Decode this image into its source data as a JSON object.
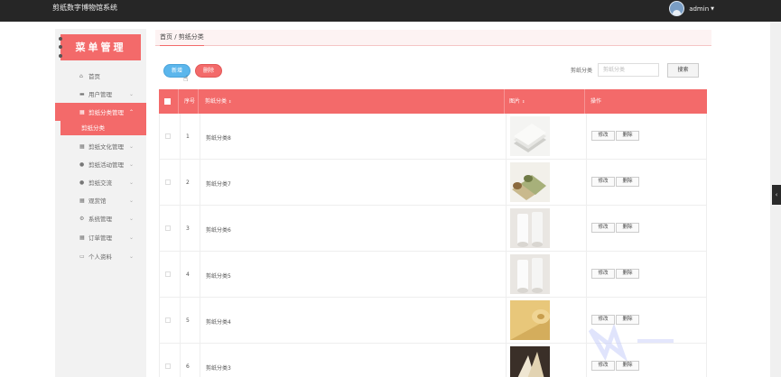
{
  "app": {
    "title": "剪纸数字博物馆系统",
    "user": "admin"
  },
  "colors": {
    "accent": "#f36a6a",
    "primary": "#5bb6ec",
    "topbar": "#262626"
  },
  "sidebar": {
    "logo_text": "菜单管理",
    "items": [
      {
        "label": "首页",
        "icon": "home-icon",
        "expandable": false,
        "active": false
      },
      {
        "label": "用户管理",
        "icon": "user-group-icon",
        "expandable": true,
        "active": false
      },
      {
        "label": "剪纸分类管理",
        "icon": "grid-icon",
        "expandable": true,
        "active": true
      },
      {
        "label": "剪纸文化管理",
        "icon": "grid-icon",
        "expandable": true,
        "active": false
      },
      {
        "label": "剪纸活动管理",
        "icon": "person-icon",
        "expandable": true,
        "active": false
      },
      {
        "label": "剪纸交流",
        "icon": "person-icon",
        "expandable": true,
        "active": false
      },
      {
        "label": "观赏馆",
        "icon": "grid-icon",
        "expandable": true,
        "active": false
      },
      {
        "label": "系统管理",
        "icon": "gear-icon",
        "expandable": true,
        "active": false
      },
      {
        "label": "订单管理",
        "icon": "grid-icon",
        "expandable": true,
        "active": false
      },
      {
        "label": "个人资料",
        "icon": "profile-icon",
        "expandable": true,
        "active": false
      }
    ],
    "submenu": {
      "label": "剪纸分类"
    }
  },
  "breadcrumb": {
    "text": "首页 / 剪纸分类"
  },
  "toolbar": {
    "add_label": "新增",
    "delete_label": "删除"
  },
  "search": {
    "label": "剪纸分类",
    "placeholder": "剪纸分类",
    "button_label": "搜索"
  },
  "table": {
    "columns": [
      "序号",
      "剪纸分类",
      "图片",
      "操作"
    ],
    "rows": [
      {
        "index": "1",
        "name": "剪纸分类8",
        "image": "white-paper-stack"
      },
      {
        "index": "2",
        "name": "剪纸分类7",
        "image": "green-beige-rolls"
      },
      {
        "index": "3",
        "name": "剪纸分类6",
        "image": "white-paper-roll"
      },
      {
        "index": "4",
        "name": "剪纸分类5",
        "image": "white-paper-roll"
      },
      {
        "index": "5",
        "name": "剪纸分类4",
        "image": "yellow-paper-roll"
      },
      {
        "index": "6",
        "name": "剪纸分类3",
        "image": "cream-paper-sheets"
      }
    ],
    "action_edit": "修改",
    "action_delete": "删除"
  }
}
